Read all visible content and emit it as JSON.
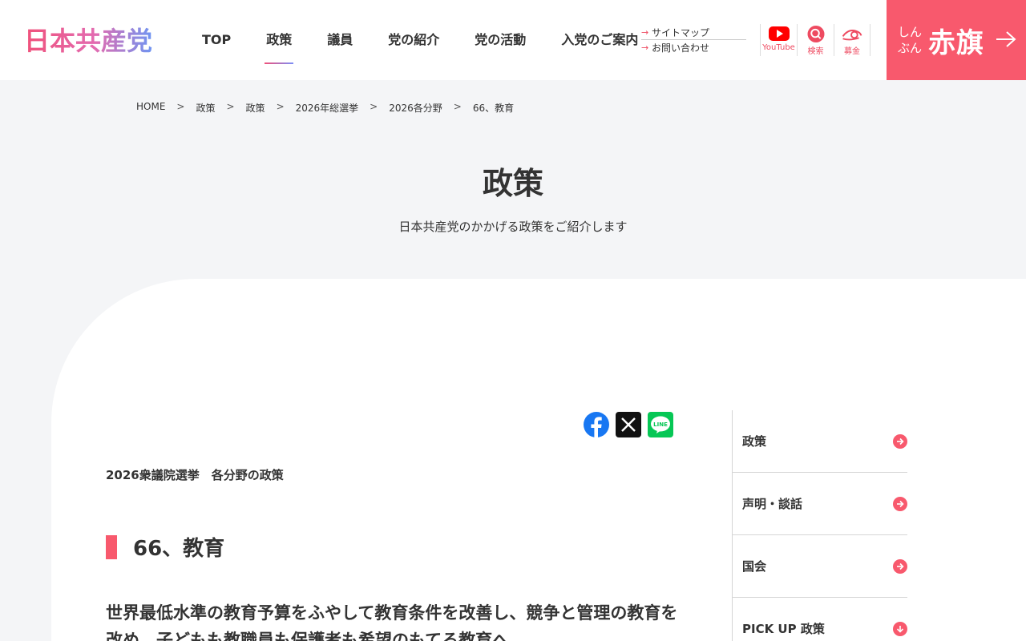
{
  "header": {
    "logo_text": "日本共産党",
    "nav": [
      "TOP",
      "政策",
      "議員",
      "党の紹介",
      "党の活動",
      "入党のご案内"
    ],
    "active_nav": "政策",
    "sublinks": [
      "サイトマップ",
      "お問い合わせ"
    ],
    "icons": [
      {
        "name": "youtube-icon",
        "label": "YouTube"
      },
      {
        "name": "search-icon",
        "label": "検索"
      },
      {
        "name": "donation-icon",
        "label": "募金"
      }
    ],
    "akahata": {
      "small": "しんぶん",
      "big": "赤旗"
    }
  },
  "breadcrumb": [
    "HOME",
    "政策",
    "政策",
    "2026年総選挙",
    "2026各分野",
    "66、教育"
  ],
  "breadcrumb_sep": ">",
  "page": {
    "title": "政策",
    "subtitle": "日本共産党のかかげる政策をご紹介します"
  },
  "article": {
    "subhead": "2026衆議院選挙　各分野の政策",
    "heading": "66、教育",
    "lead": "世界最低水準の教育予算をふやして教育条件を改善し、競争と管理の教育を改め、子どもも教職員も保護者も希望のもてる教育へ"
  },
  "share": {
    "facebook": "Facebook",
    "x": "X",
    "line": "LINE"
  },
  "sidebar": [
    "政策",
    "声明・談話",
    "国会",
    "PICK UP 政策"
  ],
  "colors": {
    "accent": "#f8596d",
    "text": "#333333",
    "background": "#f4f5f7"
  }
}
